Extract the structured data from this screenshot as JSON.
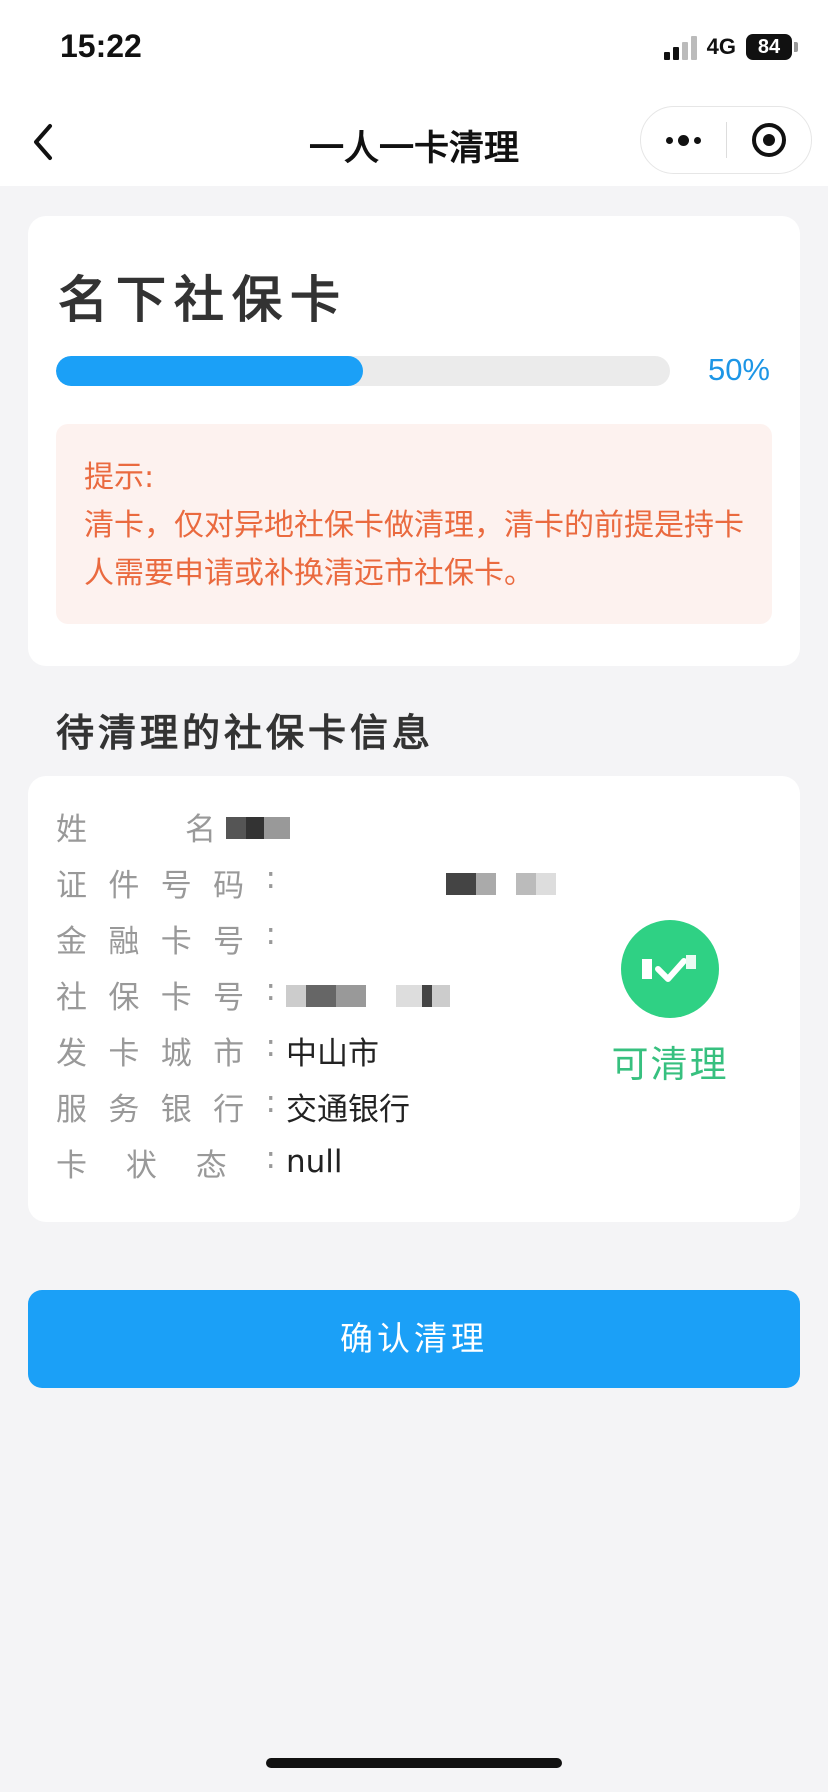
{
  "status_bar": {
    "time": "15:22",
    "network": "4G",
    "battery": "84"
  },
  "nav": {
    "title": "一人一卡清理",
    "back_icon": "chevron-left-icon",
    "more_icon": "more-dots-icon",
    "close_icon": "target-close-icon"
  },
  "summary": {
    "title": "名下社保卡",
    "progress": 0.5,
    "progress_label": "50%",
    "notice_title": "提示:",
    "notice_body": "清卡，仅对异地社保卡做清理，清卡的前提是持卡人需要申请或补换清远市社保卡。"
  },
  "section": {
    "title": "待清理的社保卡信息"
  },
  "card_info": {
    "rows": [
      {
        "label": [
          "姓",
          "名"
        ],
        "value": ""
      },
      {
        "label": [
          "证",
          "件",
          "号",
          "码",
          ":"
        ],
        "value": ""
      },
      {
        "label": [
          "金",
          "融",
          "卡",
          "号",
          ":"
        ],
        "value": ""
      },
      {
        "label": [
          "社",
          "保",
          "卡",
          "号",
          ":"
        ],
        "value": ""
      },
      {
        "label": [
          "发",
          "卡",
          "城",
          "市",
          ":"
        ],
        "value": "中山市"
      },
      {
        "label": [
          "服",
          "务",
          "银",
          "行",
          ":"
        ],
        "value": "交通银行"
      },
      {
        "label": [
          "卡",
          "状",
          "态",
          ":"
        ],
        "value": "null"
      }
    ],
    "status_label": "可清理",
    "status_color": "#2fd184"
  },
  "actions": {
    "confirm_label": "确认清理"
  },
  "colors": {
    "primary": "#1ba0f7",
    "notice_text": "#ea6a3f",
    "notice_bg": "#fdf2ef"
  }
}
